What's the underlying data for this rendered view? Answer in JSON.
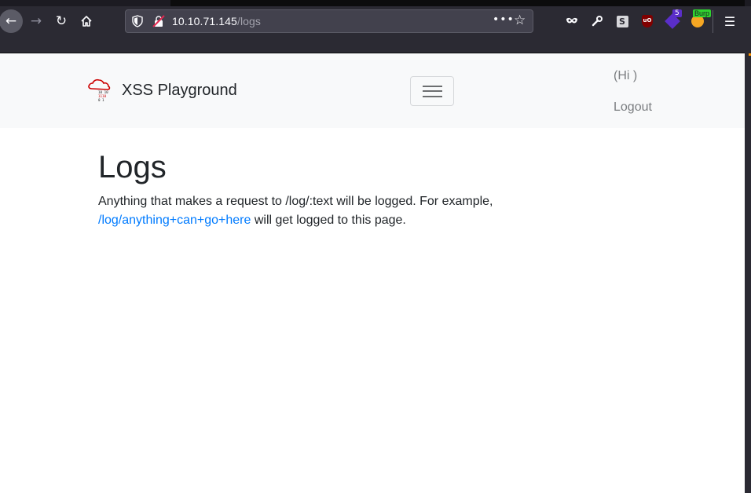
{
  "browser": {
    "url_host": "10.10.71.145",
    "url_path": "/logs",
    "extensions": {
      "sbox_label": "S",
      "ublock_label": "uO",
      "hack_badge": "5",
      "burp_badge": "Burp"
    },
    "icons": [
      "back-icon",
      "forward-icon",
      "reload-icon",
      "home-icon",
      "shield-icon",
      "insecure-lock-icon",
      "more-dots-icon",
      "bookmark-star-icon",
      "mask-icon",
      "wrench-icon",
      "menu-icon"
    ]
  },
  "navbar": {
    "brand": "XSS Playground",
    "greeting": "(Hi )",
    "logout": "Logout"
  },
  "main": {
    "title": "Logs",
    "text_1": "Anything that makes a request to /log/:text will be logged. For example,",
    "example_link": "/log/anything+can+go+here",
    "text_2": " will get logged to this page."
  },
  "colors": {
    "link": "#007bff",
    "navbar_bg": "#f8f9fa",
    "logo_red": "#cc0000"
  }
}
